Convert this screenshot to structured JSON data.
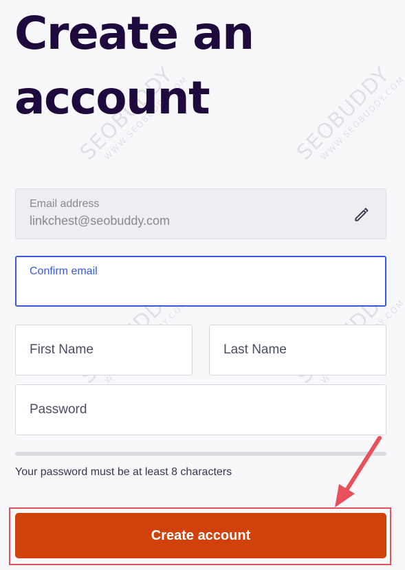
{
  "title": "Create an account",
  "form": {
    "email": {
      "label": "Email address",
      "value": "linkchest@seobuddy.com"
    },
    "confirm_email": {
      "label": "Confirm email"
    },
    "first_name": {
      "label": "First Name"
    },
    "last_name": {
      "label": "Last Name"
    },
    "password": {
      "label": "Password",
      "hint": "Your password must be at least 8 characters"
    },
    "submit_label": "Create account"
  },
  "watermark": {
    "main": "SEOBUDDY",
    "sub": "WWW.SEOBUDDY.COM"
  },
  "colors": {
    "title": "#1e0a3c",
    "focus": "#3659e3",
    "button": "#d1410c",
    "annotation": "#e8505b"
  }
}
